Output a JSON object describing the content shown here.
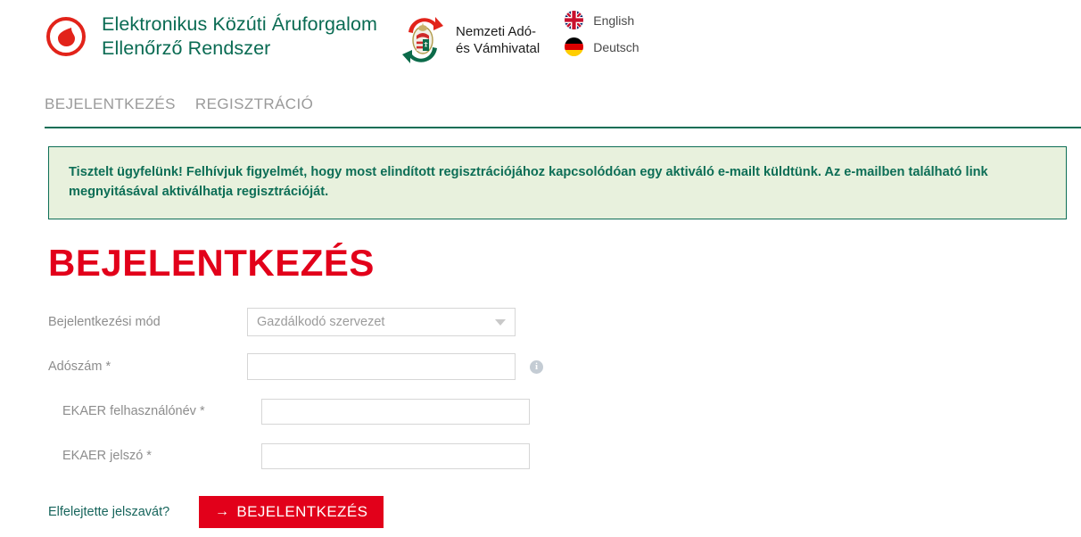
{
  "header": {
    "brand": {
      "logo_icon": "ekaer-droplet-icon",
      "line1": "Elektronikus Közúti Áruforgalom",
      "line2": "Ellenőrző Rendszer"
    },
    "authority": {
      "emblem_icon": "nav-hungarian-coat-of-arms-icon",
      "line1": "Nemzeti Adó-",
      "line2": "és Vámhivatal"
    },
    "languages": [
      {
        "icon": "uk-flag-icon",
        "label": "English"
      },
      {
        "icon": "germany-flag-icon",
        "label": "Deutsch"
      }
    ]
  },
  "tabs": [
    {
      "label": "BEJELENTKEZÉS"
    },
    {
      "label": "REGISZTRÁCIÓ"
    }
  ],
  "alert": {
    "text": "Tisztelt ügyfelünk! Felhívjuk figyelmét, hogy most elindított regisztrációjához kapcsolódóan egy aktiváló e-mailt küldtünk. Az e-mailben található link megnyitásával aktiválhatja regisztrációját."
  },
  "page": {
    "title": "BEJELENTKEZÉS"
  },
  "form": {
    "mode": {
      "label": "Bejelentkezési mód",
      "selected": "Gazdálkodó szervezet",
      "options": [
        "Gazdálkodó szervezet"
      ],
      "caret_icon": "chevron-down-icon"
    },
    "taxnumber": {
      "label": "Adószám *",
      "value": "",
      "placeholder": "",
      "info_icon": "info-circle-icon",
      "info_glyph": "i"
    },
    "username": {
      "label": "EKAER felhasználónév *",
      "value": "",
      "placeholder": ""
    },
    "password": {
      "label": "EKAER jelszó *",
      "value": "",
      "placeholder": ""
    }
  },
  "actions": {
    "forgot_password": "Elfelejtette jelszavát?",
    "login_button": "BEJELENTKEZÉS",
    "login_arrow": "→"
  },
  "colors": {
    "brand_green": "#0a6b53",
    "accent_red": "#e2001a",
    "alert_bg": "#e8f1dd",
    "alert_border": "#0d6e56",
    "label_grey": "#8d8d8d",
    "link_teal": "#17655c"
  }
}
